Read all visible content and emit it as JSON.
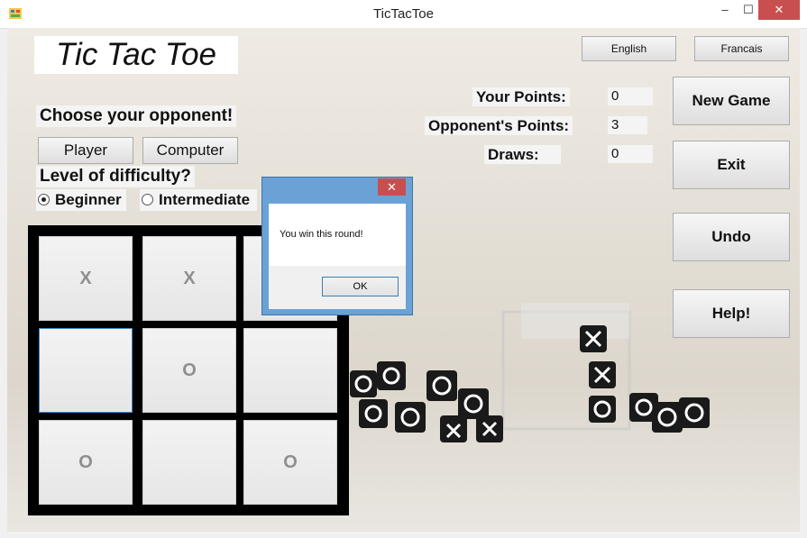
{
  "window": {
    "title": "TicTacToe",
    "minimize_label": "–",
    "maximize_label": "☐",
    "close_label": "✕"
  },
  "logo": "Tic Tac Toe",
  "language": {
    "english": "English",
    "french": "Francais"
  },
  "opponent": {
    "heading": "Choose your opponent!",
    "player": "Player",
    "computer": "Computer"
  },
  "difficulty": {
    "heading": "Level of difficulty?",
    "beginner": "Beginner",
    "intermediate": "Intermediate",
    "selected": "Beginner"
  },
  "score": {
    "your_points_label": "Your Points:",
    "your_points": "0",
    "opponent_points_label": "Opponent's Points:",
    "opponent_points": "3",
    "draws_label": "Draws:",
    "draws": "0"
  },
  "actions": {
    "new_game": "New Game",
    "exit": "Exit",
    "undo": "Undo",
    "help": "Help!"
  },
  "board": {
    "cells": [
      "X",
      "X",
      "",
      "",
      "O",
      "",
      "O",
      "",
      "O"
    ]
  },
  "dialog": {
    "message": "You win this round!",
    "ok": "OK",
    "close": "✕"
  }
}
